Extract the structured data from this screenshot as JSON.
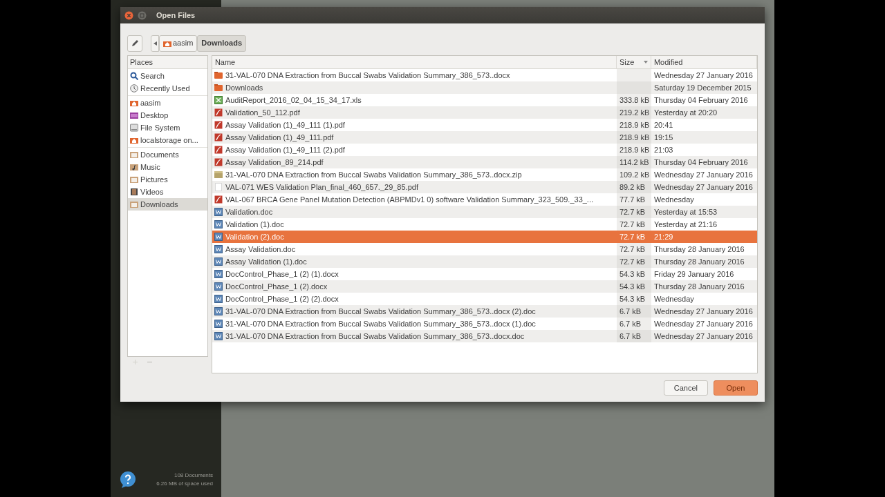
{
  "background_app": {
    "status_lines": [
      "108 Documents",
      "6.26 MB of space used"
    ]
  },
  "dialog": {
    "title": "Open Files",
    "path_bar": [
      {
        "label": "aasim",
        "kind": "home",
        "selected": false
      },
      {
        "label": "Downloads",
        "kind": "plain",
        "selected": true
      }
    ],
    "places_header": "Places",
    "places": [
      [
        {
          "label": "Search",
          "kind": "search",
          "selected": false
        },
        {
          "label": "Recently Used",
          "kind": "recent",
          "selected": false
        }
      ],
      [
        {
          "label": "aasim",
          "kind": "home",
          "selected": false
        },
        {
          "label": "Desktop",
          "kind": "desktop",
          "selected": false
        },
        {
          "label": "File System",
          "kind": "drive",
          "selected": false
        },
        {
          "label": "localstorage on...",
          "kind": "home",
          "selected": false
        }
      ],
      [
        {
          "label": "Documents",
          "kind": "folder",
          "selected": false
        },
        {
          "label": "Music",
          "kind": "music",
          "selected": false
        },
        {
          "label": "Pictures",
          "kind": "folder",
          "selected": false
        },
        {
          "label": "Videos",
          "kind": "video",
          "selected": false
        },
        {
          "label": "Downloads",
          "kind": "folder",
          "selected": true
        }
      ]
    ],
    "columns": [
      {
        "label": "Name",
        "sorted": false
      },
      {
        "label": "Size",
        "sorted": true
      },
      {
        "label": "Modified",
        "sorted": false
      }
    ],
    "files": [
      {
        "name": "31-VAL-070 DNA Extraction from Buccal Swabs Validation Summary_386_573..docx",
        "kind": "folder",
        "modified": "Wednesday 27 January 2016",
        "selected": false
      },
      {
        "name": "Downloads",
        "kind": "folder",
        "modified": "Saturday 19 December 2015",
        "selected": false
      },
      {
        "name": "AuditReport_2016_02_04_15_34_17.xls",
        "kind": "sheet",
        "size": "333.8 kB",
        "modified": "Thursday 04 February 2016",
        "selected": false
      },
      {
        "name": "Validation_50_112.pdf",
        "kind": "pdf",
        "size": "219.2 kB",
        "modified": "Yesterday at 20:20",
        "selected": false
      },
      {
        "name": "Assay Validation (1)_49_111 (1).pdf",
        "kind": "pdf",
        "size": "218.9 kB",
        "modified": "20:41",
        "selected": false
      },
      {
        "name": "Assay Validation (1)_49_111.pdf",
        "kind": "pdf",
        "size": "218.9 kB",
        "modified": "19:15",
        "selected": false
      },
      {
        "name": "Assay Validation (1)_49_111 (2).pdf",
        "kind": "pdf",
        "size": "218.9 kB",
        "modified": "21:03",
        "selected": false
      },
      {
        "name": "Assay Validation_89_214.pdf",
        "kind": "pdf",
        "size": "114.2 kB",
        "modified": "Thursday 04 February 2016",
        "selected": false
      },
      {
        "name": "31-VAL-070 DNA Extraction from Buccal Swabs Validation Summary_386_573..docx.zip",
        "kind": "archive",
        "size": "109.2 kB",
        "modified": "Wednesday 27 January 2016",
        "selected": false
      },
      {
        "name": "VAL-071 WES Validation Plan_final_460_657._29_85.pdf",
        "kind": "blank",
        "size": "89.2 kB",
        "modified": "Wednesday 27 January 2016",
        "selected": false
      },
      {
        "name": "VAL-067 BRCA Gene Panel Mutation Detection (ABPMDv1 0) software Validation Summary_323_509._33_...",
        "kind": "pdf",
        "size": "77.7 kB",
        "modified": "Wednesday",
        "selected": false
      },
      {
        "name": "Validation.doc",
        "kind": "doc",
        "size": "72.7 kB",
        "modified": "Yesterday at 15:53",
        "selected": false
      },
      {
        "name": "Validation (1).doc",
        "kind": "doc",
        "size": "72.7 kB",
        "modified": "Yesterday at 21:16",
        "selected": false
      },
      {
        "name": "Validation (2).doc",
        "kind": "doc",
        "size": "72.7 kB",
        "modified": "21:29",
        "selected": true
      },
      {
        "name": "Assay Validation.doc",
        "kind": "doc",
        "size": "72.7 kB",
        "modified": "Thursday 28 January 2016",
        "selected": false
      },
      {
        "name": "Assay Validation (1).doc",
        "kind": "doc",
        "size": "72.7 kB",
        "modified": "Thursday 28 January 2016",
        "selected": false
      },
      {
        "name": "DocControl_Phase_1 (2) (1).docx",
        "kind": "doc",
        "size": "54.3 kB",
        "modified": "Friday 29 January 2016",
        "selected": false
      },
      {
        "name": "DocControl_Phase_1 (2).docx",
        "kind": "doc",
        "size": "54.3 kB",
        "modified": "Thursday 28 January 2016",
        "selected": false
      },
      {
        "name": "DocControl_Phase_1 (2) (2).docx",
        "kind": "doc",
        "size": "54.3 kB",
        "modified": "Wednesday",
        "selected": false
      },
      {
        "name": "31-VAL-070 DNA Extraction from Buccal Swabs Validation Summary_386_573..docx (2).doc",
        "kind": "doc",
        "size": "6.7 kB",
        "modified": "Wednesday 27 January 2016",
        "selected": false
      },
      {
        "name": "31-VAL-070 DNA Extraction from Buccal Swabs Validation Summary_386_573..docx (1).doc",
        "kind": "doc",
        "size": "6.7 kB",
        "modified": "Wednesday 27 January 2016",
        "selected": false
      },
      {
        "name": "31-VAL-070 DNA Extraction from Buccal Swabs Validation Summary_386_573..docx.doc",
        "kind": "doc",
        "size": "6.7 kB",
        "modified": "Wednesday 27 January 2016",
        "selected": false
      }
    ],
    "buttons": [
      {
        "label": "Cancel",
        "kind": "secondary"
      },
      {
        "label": "Open",
        "kind": "primary"
      }
    ]
  }
}
